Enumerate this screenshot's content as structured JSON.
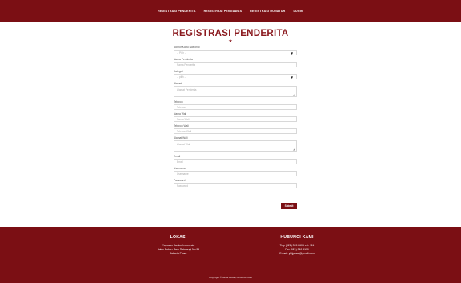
{
  "nav": {
    "items": [
      "REGISTRASI PENDERITA",
      "REGISTRASI PENGAWAS",
      "REGISTRASI DONATUR",
      "LOGIN"
    ]
  },
  "page": {
    "title": "REGISTRASI PENDERITA",
    "divider_icon": "star-icon"
  },
  "form": {
    "fields": [
      {
        "label": "Nomor Kartu Nasional",
        "type": "select",
        "value": "-- Pilih --"
      },
      {
        "label": "Nama Penderita",
        "type": "text",
        "placeholder": "Nama Penderita"
      },
      {
        "label": "Kategori",
        "type": "select",
        "value": "-- pilih --"
      },
      {
        "label": "Alamat",
        "type": "textarea",
        "placeholder": "Alamat Penderita"
      },
      {
        "label": "Telepon",
        "type": "text",
        "placeholder": "Telepon"
      },
      {
        "label": "Nama Wali",
        "type": "text",
        "placeholder": "Nama Wali"
      },
      {
        "label": "Telepon Wali",
        "type": "text",
        "placeholder": "Telepon Wali"
      },
      {
        "label": "Alamat Wali",
        "type": "textarea",
        "placeholder": "Alamat Wali"
      },
      {
        "label": "Email",
        "type": "text",
        "placeholder": "Email"
      },
      {
        "label": "Username",
        "type": "text",
        "placeholder": "Username"
      },
      {
        "label": "Password",
        "type": "text",
        "placeholder": "Password"
      }
    ],
    "submit_label": "Submit"
  },
  "footer": {
    "left_title": "LOKASI",
    "left_lines": [
      "Yayasan Kanker Indonesia",
      "Jalan Dokter Sam Ratulangi No.35",
      "Jakarta Pusat"
    ],
    "right_title": "HUBUNGI KAMI",
    "right_lines": [
      "Telp (021) 315 2603 ext. 111",
      "Fax (021) 310 6170",
      "E-mail: ykijpusat@gmail.com"
    ],
    "copyright": "Copyright © Sinds Hebay-Sinsoritu 2020"
  },
  "colors": {
    "brand": "#7b0f14",
    "title": "#8b1a1f",
    "background": "#ffffff"
  }
}
